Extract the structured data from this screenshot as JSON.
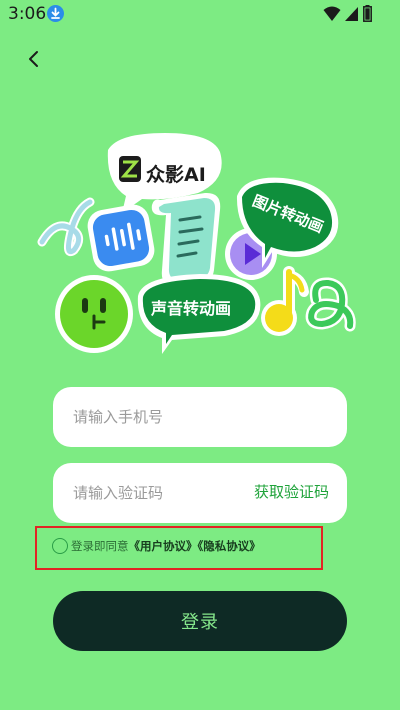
{
  "status": {
    "time": "3:06",
    "icons": [
      "download-icon",
      "wifi-icon",
      "signal-icon",
      "battery-icon"
    ]
  },
  "nav": {
    "back_icon": "chevron-left-icon"
  },
  "illustration": {
    "brand": "众影AI",
    "sticker_dynamic": "图片转动画",
    "sticker_voice": "声音转动画"
  },
  "form": {
    "phone_placeholder": "请输入手机号",
    "code_placeholder": "请输入验证码",
    "get_code_label": "获取验证码",
    "agree_prefix": "登录即同意",
    "user_agreement": "《用户协议》",
    "privacy_policy": "《隐私协议》",
    "login_label": "登录"
  },
  "colors": {
    "background": "#7DEB83",
    "login_button": "#0e2a25",
    "accent": "#1fa33a",
    "highlight_box": "#e32424"
  }
}
